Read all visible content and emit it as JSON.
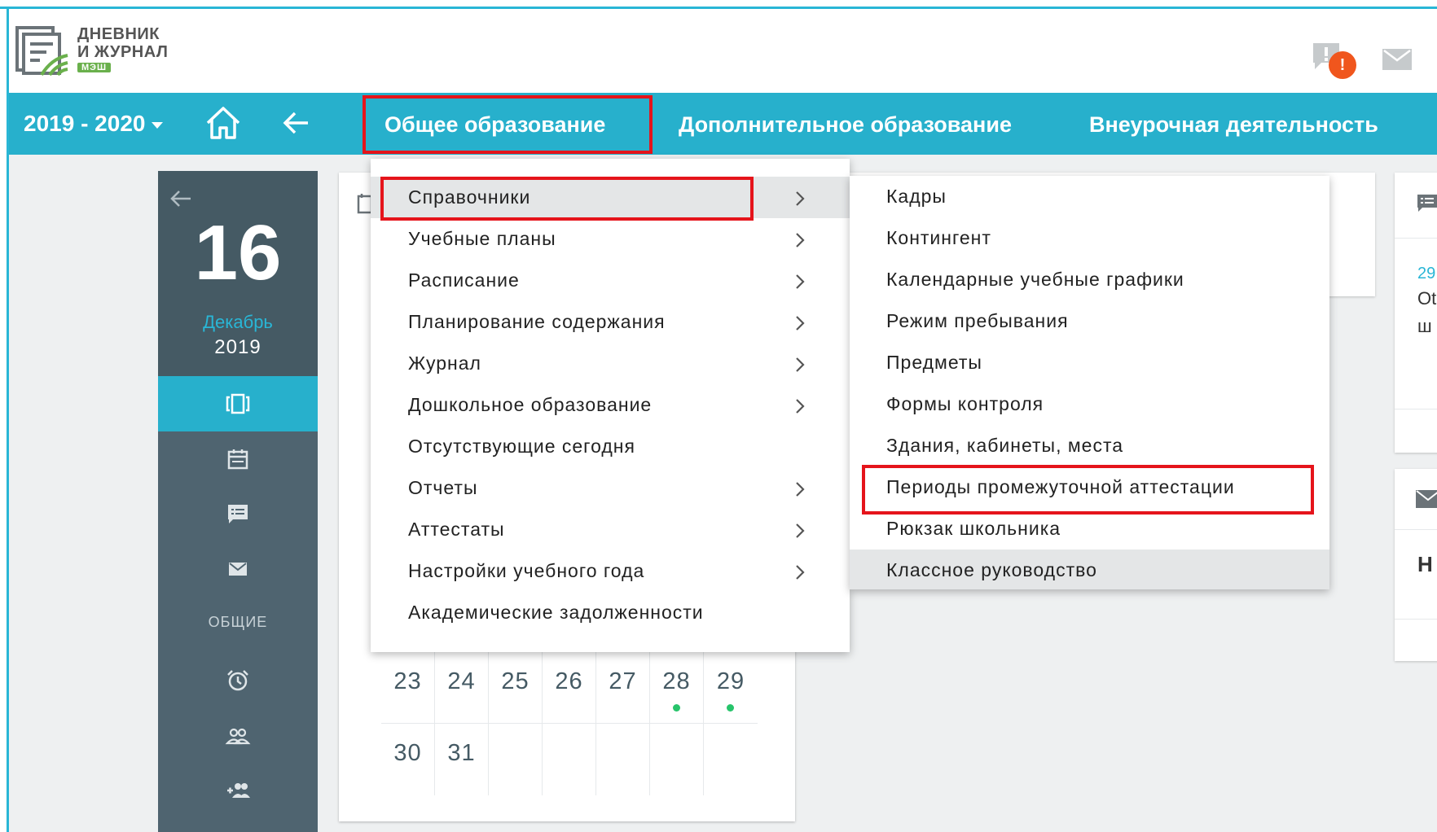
{
  "app": {
    "logo_line1": "ДНЕВНИК",
    "logo_line2": "И ЖУРНАЛ",
    "logo_badge": "МЭШ",
    "notification_badge": "!"
  },
  "topnav": {
    "year": "2019 - 2020",
    "tabs": [
      {
        "label": "Общее образование"
      },
      {
        "label": "Дополнительное образование"
      },
      {
        "label": "Внеурочная деятельность"
      }
    ]
  },
  "sidebar": {
    "day": "16",
    "month": "Декабрь",
    "year": "2019",
    "section_label": "ОБЩИЕ"
  },
  "calendar": {
    "rows": [
      [
        {
          "day": "23",
          "dot": false
        },
        {
          "day": "24",
          "dot": false
        },
        {
          "day": "25",
          "dot": false
        },
        {
          "day": "26",
          "dot": false
        },
        {
          "day": "27",
          "dot": false
        },
        {
          "day": "28",
          "dot": true
        },
        {
          "day": "29",
          "dot": true
        }
      ],
      [
        {
          "day": "30",
          "dot": false
        },
        {
          "day": "31",
          "dot": false
        },
        {
          "day": "",
          "dot": false
        },
        {
          "day": "",
          "dot": false
        },
        {
          "day": "",
          "dot": false
        },
        {
          "day": "",
          "dot": false
        },
        {
          "day": "",
          "dot": false
        }
      ]
    ]
  },
  "menu_main": {
    "items": [
      {
        "label": "Справочники",
        "submenu": true,
        "active": true
      },
      {
        "label": "Учебные планы",
        "submenu": true
      },
      {
        "label": "Расписание",
        "submenu": true
      },
      {
        "label": "Планирование содержания",
        "submenu": true
      },
      {
        "label": "Журнал",
        "submenu": true
      },
      {
        "label": "Дошкольное образование",
        "submenu": true
      },
      {
        "label": "Отсутствующие сегодня",
        "submenu": false
      },
      {
        "label": "Отчеты",
        "submenu": true
      },
      {
        "label": "Аттестаты",
        "submenu": true
      },
      {
        "label": "Настройки учебного года",
        "submenu": true
      },
      {
        "label": "Академические задолженности",
        "submenu": false
      }
    ]
  },
  "menu_sub": {
    "items": [
      {
        "label": "Кадры"
      },
      {
        "label": "Контингент"
      },
      {
        "label": "Календарные учебные графики"
      },
      {
        "label": "Режим пребывания"
      },
      {
        "label": "Предметы"
      },
      {
        "label": "Формы контроля"
      },
      {
        "label": "Здания, кабинеты, места"
      },
      {
        "label": "Периоды промежуточной аттестации"
      },
      {
        "label": "Рюкзак школьника"
      },
      {
        "label": "Классное руководство",
        "active": true
      }
    ]
  },
  "right_panel": {
    "date_fragment": "29",
    "text_fragment_1": "Ot",
    "text_fragment_2": "ш",
    "heading_fragment": "H"
  },
  "colors": {
    "accent": "#27b0cc",
    "sidebar_dark": "#455a64",
    "sidebar": "#4f6470",
    "highlight_red": "#e5141b",
    "badge_orange": "#f0561d",
    "dot_green": "#27c46b"
  },
  "icons": {
    "logo": "diary-logo-icon",
    "notification": "message-alert-icon",
    "mail": "mail-icon",
    "home": "home-icon",
    "back": "arrow-left-icon",
    "chevron": "chevron-right-icon"
  }
}
